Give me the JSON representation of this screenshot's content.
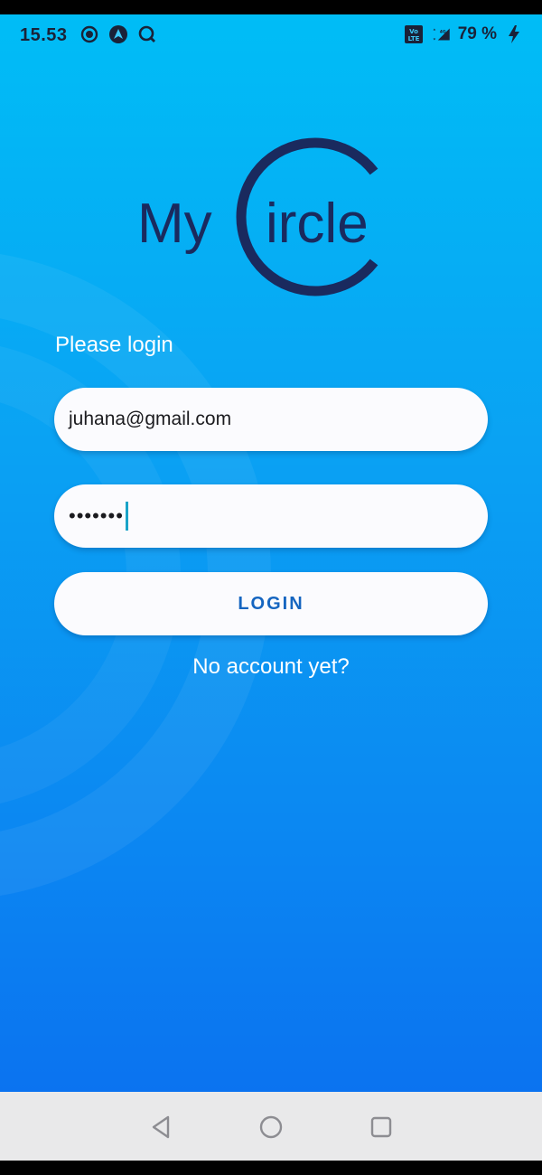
{
  "status_bar": {
    "time": "15.53",
    "battery": "79 %",
    "icons_left": [
      "record-icon",
      "navigation-icon",
      "search-q-icon"
    ],
    "icons_right": [
      "volte-icon",
      "signal-4g-icon",
      "charging-icon"
    ]
  },
  "logo": {
    "text_my": "My",
    "text_ircle": "ircle",
    "color": "#1a2a5e"
  },
  "login_form": {
    "prompt": "Please login",
    "email_value": "juhana@gmail.com",
    "password_mask": "•••••••",
    "login_label": "LOGIN",
    "no_account_link": "No account yet?"
  },
  "nav_bar": {
    "buttons": [
      "back-icon",
      "home-icon",
      "recents-icon"
    ]
  },
  "colors": {
    "background_top": "#00bdf6",
    "background_bottom": "#0b73f0",
    "button_text": "#1565c0",
    "field_bg": "#fbfbfe"
  }
}
